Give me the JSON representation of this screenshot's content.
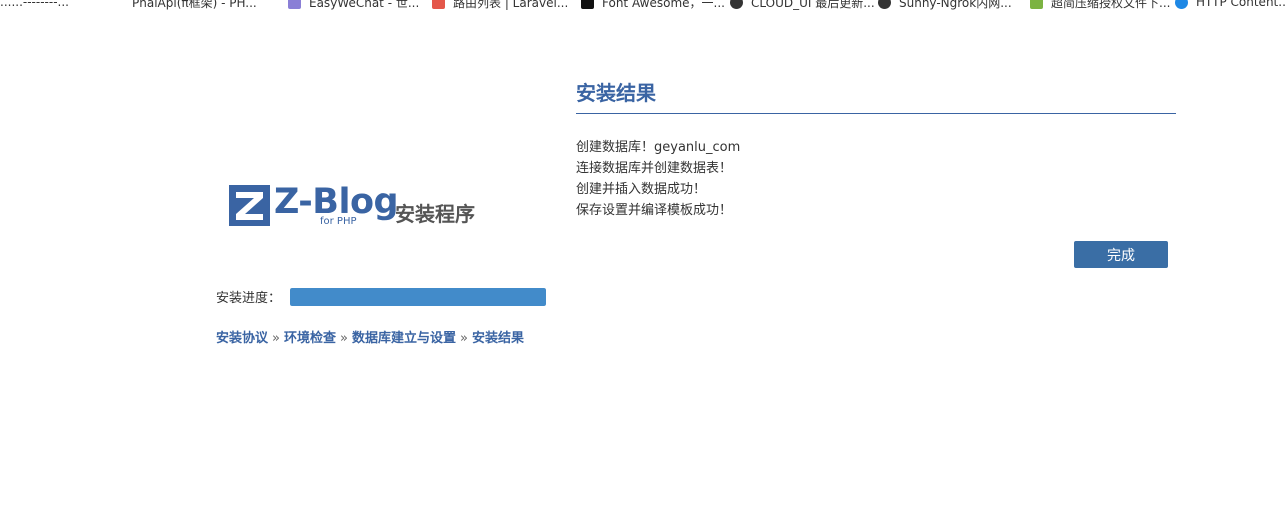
{
  "bookmarks": [
    {
      "label": "......--------...",
      "icon": "page-icon",
      "color": "#888888"
    },
    {
      "label": "PhalApi(π框架) - PH...",
      "icon": "page-icon",
      "color": "#cccccc"
    },
    {
      "label": "EasyWeChat - 世...",
      "icon": "easywechat-icon",
      "color": "#8a7fd6"
    },
    {
      "label": "路由列表 | Laravel...",
      "icon": "laravel-icon",
      "color": "#e4574a"
    },
    {
      "label": "Font Awesome，一...",
      "icon": "font-awesome-icon",
      "color": "#111111"
    },
    {
      "label": "CLOUD_UI 最后更新...",
      "icon": "github-icon",
      "color": "#333333"
    },
    {
      "label": "Sunny-Ngrok内网...",
      "icon": "github-icon",
      "color": "#333333"
    },
    {
      "label": "超简压缩授权文件下...",
      "icon": "leaf-icon",
      "color": "#7cb342"
    },
    {
      "label": "HTTP Content...",
      "icon": "globe-icon",
      "color": "#1e88e5"
    }
  ],
  "logo": {
    "brand": "Z-Blog",
    "sub": "for PHP",
    "installer": "安装程序"
  },
  "progress": {
    "label": "安装进度：",
    "value": 1.0
  },
  "steps": {
    "items": [
      "安装协议",
      "环境检查",
      "数据库建立与设置",
      "安装结果"
    ],
    "separator": "»"
  },
  "result": {
    "title": "安装结果",
    "lines": [
      "创建数据库！geyanlu_com",
      "连接数据库并创建数据表！",
      "创建并插入数据成功！",
      "保存设置并编译模板成功！"
    ],
    "finish_label": "完成"
  },
  "colors": {
    "accent": "#3a64a3",
    "progress": "#428bca",
    "button": "#3a6ea5"
  }
}
